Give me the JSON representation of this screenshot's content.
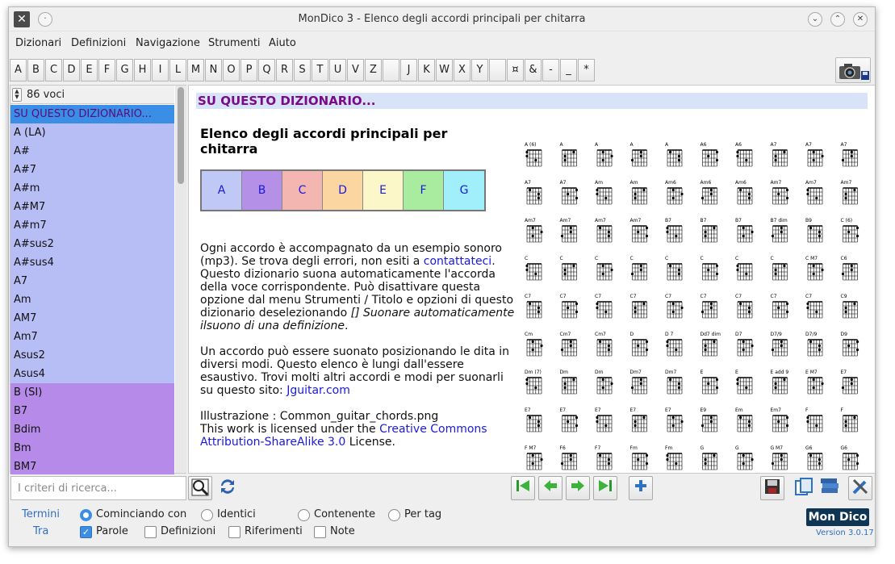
{
  "window": {
    "title": "MonDico 3 - Elenco degli accordi principali per chitarra",
    "app_icon": "x-logo-icon"
  },
  "menu": [
    "Dizionari",
    "Definizioni",
    "Navigazione",
    "Strumenti",
    "Aiuto"
  ],
  "letters": [
    "A",
    "B",
    "C",
    "D",
    "E",
    "F",
    "G",
    "H",
    "I",
    "L",
    "M",
    "N",
    "O",
    "P",
    "Q",
    "R",
    "S",
    "T",
    "U",
    "V",
    "Z",
    "",
    "J",
    "K",
    "W",
    "X",
    "Y",
    "",
    "¤",
    "&",
    "-",
    "_",
    "*"
  ],
  "list": {
    "count_label": "86 voci",
    "items": [
      {
        "label": "SU QUESTO DIZIONARIO...",
        "group": "selected"
      },
      {
        "label": "A (LA)",
        "group": "a"
      },
      {
        "label": "A#",
        "group": "a"
      },
      {
        "label": "A#7",
        "group": "a"
      },
      {
        "label": "A#m",
        "group": "a"
      },
      {
        "label": "A#M7",
        "group": "a"
      },
      {
        "label": "A#m7",
        "group": "a"
      },
      {
        "label": "A#sus2",
        "group": "a"
      },
      {
        "label": "A#sus4",
        "group": "a"
      },
      {
        "label": "A7",
        "group": "a"
      },
      {
        "label": "Am",
        "group": "a"
      },
      {
        "label": "AM7",
        "group": "a"
      },
      {
        "label": "Am7",
        "group": "a"
      },
      {
        "label": "Asus2",
        "group": "a"
      },
      {
        "label": "Asus4",
        "group": "a"
      },
      {
        "label": "B (SI)",
        "group": "b"
      },
      {
        "label": "B7",
        "group": "b"
      },
      {
        "label": "Bdim",
        "group": "b"
      },
      {
        "label": "Bm",
        "group": "b"
      },
      {
        "label": "BM7",
        "group": "b"
      }
    ]
  },
  "content": {
    "header": "SU QUESTO DIZIONARIO...",
    "title": "Elenco degli accordi principali per chitarra",
    "chord_cells": [
      {
        "label": "A",
        "color": "#c0c8f5"
      },
      {
        "label": "B",
        "color": "#b491e6"
      },
      {
        "label": "C",
        "color": "#f3b6b0"
      },
      {
        "label": "D",
        "color": "#fbd6a0"
      },
      {
        "label": "E",
        "color": "#fcf7c9"
      },
      {
        "label": "F",
        "color": "#a9ec9f"
      },
      {
        "label": "G",
        "color": "#a0effa"
      }
    ],
    "p1_a": "Ogni accordo è accompagnato da un esempio sonoro (mp3). Se trova degli errori, non esiti a ",
    "p1_link": "contattateci",
    "p1_b": ".",
    "p2_a": "Questo dizionario suona automaticamente l'accorda della voce corrispondente. Può disattivare questa opzione dal menu Strumenti / Titolo e opzioni di questo dizionario deselezionando ",
    "p2_italic": "[] Suonare automaticamente ilsuono di una definizione",
    "p2_b": ".",
    "p3_a": "Un accordo può essere suonato posizionando le dita in diversi modi. Questo elenco è lungi dall'essere esaustivo. Trovi molti altri accordi e modi per suonarli su questo sito: ",
    "p3_link": "Jguitar.com",
    "p4": "Illustrazione : Common_guitar_chords.png",
    "p5_a": "This work is licensed under the ",
    "p5_link": "Creative Commons Attribution-ShareAlike 3.0",
    "p5_b": " License."
  },
  "chord_chart": {
    "rows": [
      [
        "A (6)",
        "A",
        "A",
        "A",
        "A",
        "A6",
        "A6",
        "A7",
        "A7",
        "A7"
      ],
      [
        "A7",
        "A7",
        "Am",
        "Am",
        "Am6",
        "Am6",
        "Am6",
        "Am7",
        "Am7",
        "Am7"
      ],
      [
        "Am7",
        "Am7",
        "Am7",
        "Am7",
        "B7",
        "B7",
        "B7",
        "B7 dim",
        "B9",
        "C (6)"
      ],
      [
        "C",
        "C",
        "C",
        "C",
        "C",
        "C",
        "C",
        "C",
        "C M7",
        "C6"
      ],
      [
        "C7",
        "C7",
        "C7",
        "C7",
        "C7",
        "C7",
        "C7",
        "C7",
        "C7",
        "C9"
      ],
      [
        "Cm",
        "Cm7",
        "Cm7",
        "D",
        "D 7",
        "Dd7 dim",
        "D7",
        "D7/9",
        "D7/9",
        "D9"
      ],
      [
        "Dm (7)",
        "Dm",
        "Dm",
        "Dm7",
        "Dm7",
        "E",
        "E",
        "E add 9",
        "E M7",
        "E7"
      ],
      [
        "E7",
        "E7",
        "E7",
        "E7",
        "E7",
        "E9",
        "Em",
        "Em7",
        "F",
        "F"
      ],
      [
        "F M7",
        "F6",
        "F7",
        "Fm",
        "Fm",
        "G",
        "G",
        "G M7",
        "G6",
        "G6"
      ]
    ]
  },
  "bottom": {
    "search_placeholder": "I criteri di ricerca...",
    "search_icon": "magnifier-icon",
    "refresh_icon": "refresh-icon",
    "nav_icons": [
      "first-icon",
      "prev-icon",
      "next-icon",
      "last-icon",
      "add-icon"
    ],
    "tool_icons": [
      "save-disk-icon",
      "save-copy-icon",
      "books-icon",
      "tools-icon"
    ]
  },
  "options": {
    "termini_label": "Termini",
    "tra_label": "Tra",
    "radios": [
      {
        "label": "Cominciando con",
        "checked": true
      },
      {
        "label": "Identici",
        "checked": false
      },
      {
        "label": "Contenente",
        "checked": false
      },
      {
        "label": "Per tag",
        "checked": false
      }
    ],
    "checks": [
      {
        "label": "Parole",
        "checked": true
      },
      {
        "label": "Definizioni",
        "checked": false
      },
      {
        "label": "Riferimenti",
        "checked": false
      },
      {
        "label": "Note",
        "checked": false
      }
    ],
    "logo": "Mon Dico",
    "version": "Version 3.0.17"
  }
}
